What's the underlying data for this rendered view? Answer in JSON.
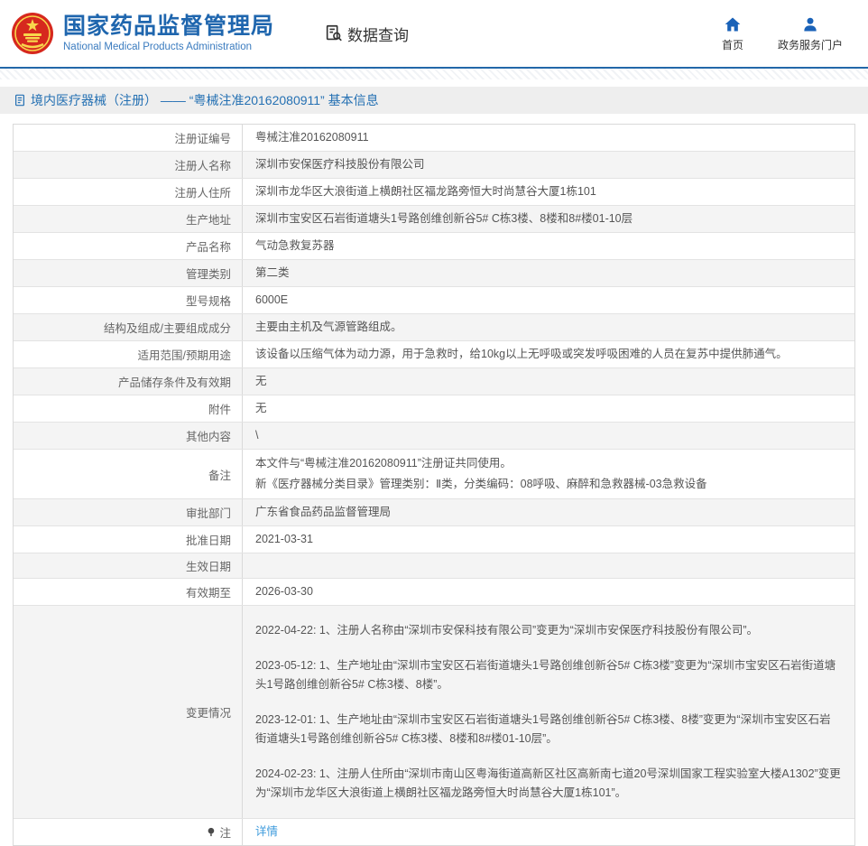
{
  "header": {
    "agency_name_zh": "国家药品监督管理局",
    "agency_name_en": "National Medical Products Administration",
    "nav_data_query": "数据查询",
    "nav_home": "首页",
    "nav_gov_portal": "政务服务门户"
  },
  "page": {
    "title": "境内医疗器械（注册） —— “粤械注准20162080911” 基本信息"
  },
  "colors": {
    "brand_blue": "#1f66ae",
    "divider_blue": "#2368a9",
    "title_text_blue": "#2470b3",
    "link_blue": "#3e9bdc",
    "emblem_red": "#d6281e",
    "emblem_gold": "#f8d64c",
    "row_alt_gray": "#f4f4f4"
  },
  "table": {
    "rows": [
      {
        "label": "注册证编号",
        "value": "粤械注准20162080911"
      },
      {
        "label": "注册人名称",
        "value": "深圳市安保医疗科技股份有限公司"
      },
      {
        "label": "注册人住所",
        "value": "深圳市龙华区大浪街道上横朗社区福龙路旁恒大时尚慧谷大厦1栋101"
      },
      {
        "label": "生产地址",
        "value": "深圳市宝安区石岩街道塘头1号路创维创新谷5# C栋3楼、8楼和8#楼01-10层"
      },
      {
        "label": "产品名称",
        "value": "气动急救复苏器"
      },
      {
        "label": "管理类别",
        "value": "第二类"
      },
      {
        "label": "型号规格",
        "value": "6000E"
      },
      {
        "label": "结构及组成/主要组成成分",
        "value": "主要由主机及气源管路组成。"
      },
      {
        "label": "适用范围/预期用途",
        "value": "该设备以压缩气体为动力源，用于急救时，给10kg以上无呼吸或突发呼吸困难的人员在复苏中提供肺通气。"
      },
      {
        "label": "产品储存条件及有效期",
        "value": "无"
      },
      {
        "label": "附件",
        "value": "无"
      },
      {
        "label": "其他内容",
        "value": "\\"
      },
      {
        "label": "备注",
        "value": [
          "本文件与“粤械注准20162080911”注册证共同使用。",
          "新《医疗器械分类目录》管理类别：Ⅱ类，分类编码：08呼吸、麻醉和急救器械-03急救设备"
        ],
        "multiline": "tight"
      },
      {
        "label": "审批部门",
        "value": "广东省食品药品监督管理局"
      },
      {
        "label": "批准日期",
        "value": "2021-03-31"
      },
      {
        "label": "生效日期",
        "value": ""
      },
      {
        "label": "有效期至",
        "value": "2026-03-30"
      },
      {
        "label": "变更情况",
        "value": [
          "2022-04-22: 1、注册人名称由“深圳市安保科技有限公司”变更为“深圳市安保医疗科技股份有限公司”。",
          "2023-05-12: 1、生产地址由“深圳市宝安区石岩街道塘头1号路创维创新谷5# C栋3楼”变更为“深圳市宝安区石岩街道塘头1号路创维创新谷5# C栋3楼、8楼”。",
          "2023-12-01: 1、生产地址由“深圳市宝安区石岩街道塘头1号路创维创新谷5# C栋3楼、8楼”变更为“深圳市宝安区石岩街道塘头1号路创维创新谷5# C栋3楼、8楼和8#楼01-10层”。",
          "2024-02-23: 1、注册人住所由“深圳市南山区粤海街道高新区社区高新南七道20号深圳国家工程实验室大楼A1302”变更为“深圳市龙华区大浪街道上横朗社区福龙路旁恒大时尚慧谷大厦1栋101”。"
        ],
        "multiline": "spaced"
      },
      {
        "label": "注",
        "value": "详情",
        "link": true,
        "label_icon": "pin"
      }
    ]
  }
}
